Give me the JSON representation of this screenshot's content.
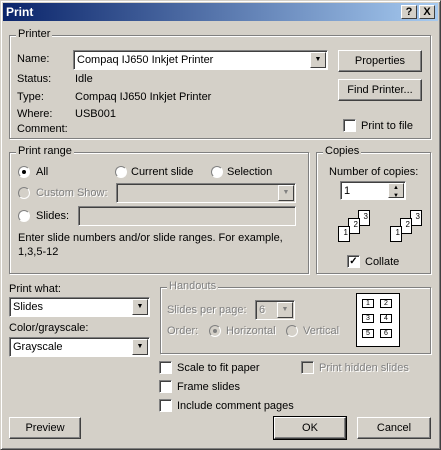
{
  "window": {
    "title": "Print"
  },
  "title_buttons": {
    "help": "?",
    "close": "X"
  },
  "printer": {
    "legend": "Printer",
    "name_label": "Name:",
    "name_value": "Compaq IJ650 Inkjet Printer",
    "status_label": "Status:",
    "status_value": "Idle",
    "type_label": "Type:",
    "type_value": "Compaq IJ650 Inkjet Printer",
    "where_label": "Where:",
    "where_value": "USB001",
    "comment_label": "Comment:",
    "properties_btn": "Properties",
    "find_printer_btn": "Find Printer...",
    "print_to_file": "Print to file"
  },
  "print_range": {
    "legend": "Print range",
    "all": "All",
    "current_slide": "Current slide",
    "selection": "Selection",
    "custom_show": "Custom Show:",
    "slides": "Slides:",
    "hint": "Enter slide numbers and/or slide ranges. For example, 1,3,5-12"
  },
  "copies": {
    "legend": "Copies",
    "number_label": "Number of copies:",
    "number_value": "1",
    "collate": "Collate"
  },
  "print_what": {
    "label": "Print what:",
    "value": "Slides"
  },
  "color": {
    "label": "Color/grayscale:",
    "value": "Grayscale"
  },
  "handouts": {
    "legend": "Handouts",
    "slides_per_page_label": "Slides per page:",
    "slides_per_page_value": "6",
    "order_label": "Order:",
    "horizontal": "Horizontal",
    "vertical": "Vertical",
    "preview_slots": [
      "1",
      "2",
      "3",
      "4",
      "5",
      "6"
    ]
  },
  "options": {
    "scale_to_fit": "Scale to fit paper",
    "frame_slides": "Frame slides",
    "include_comments": "Include comment pages",
    "print_hidden": "Print hidden slides"
  },
  "footer": {
    "preview": "Preview",
    "ok": "OK",
    "cancel": "Cancel"
  },
  "collate_pages": [
    "1",
    "2",
    "3",
    "1",
    "2",
    "3"
  ],
  "colors": {
    "title_start": "#0a246a",
    "title_end": "#a6caf0",
    "face": "#d4d0c8"
  }
}
